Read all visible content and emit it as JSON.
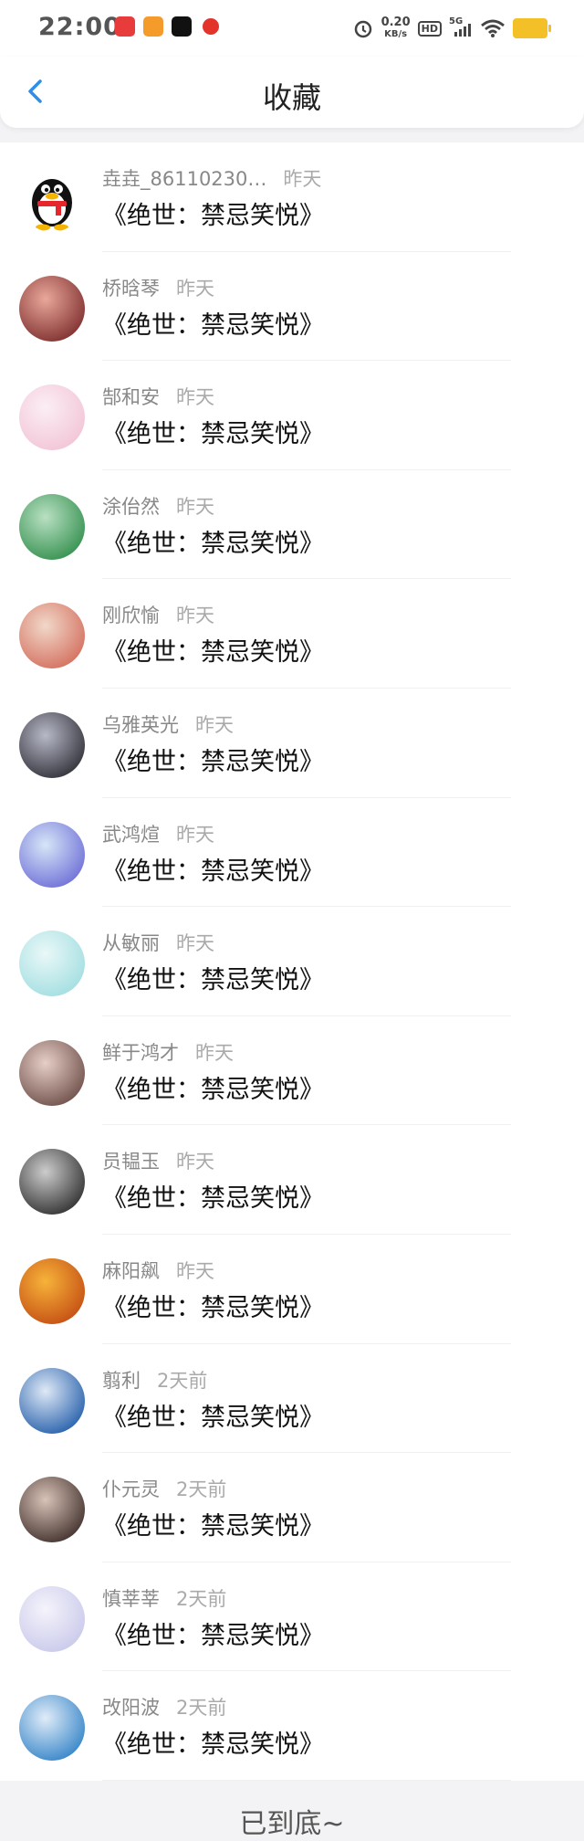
{
  "status": {
    "time": "22:00",
    "net_speed_value": "0.20",
    "net_speed_unit": "KB/s",
    "hd_label": "HD",
    "signal_label": "5G",
    "icons": [
      "alarm-icon",
      "hd-icon",
      "signal-icon",
      "wifi-icon",
      "battery-icon"
    ]
  },
  "header": {
    "title": "收藏"
  },
  "items": [
    {
      "name": "垚垚_86110230…",
      "time": "昨天",
      "msg": "《绝世：禁忌笑悦》",
      "avatar_kind": "qq-penguin"
    },
    {
      "name": "桥晗琴",
      "time": "昨天",
      "msg": "《绝世：禁忌笑悦》",
      "avatar_kind": "photo",
      "c1": "#7a2a2a",
      "c2": "#e9a79a"
    },
    {
      "name": "郜和安",
      "time": "昨天",
      "msg": "《绝世：禁忌笑悦》",
      "avatar_kind": "photo",
      "c1": "#f2c3d6",
      "c2": "#fbeef4"
    },
    {
      "name": "涂佁然",
      "time": "昨天",
      "msg": "《绝世：禁忌笑悦》",
      "avatar_kind": "photo",
      "c1": "#2f8d4a",
      "c2": "#b9e0c3"
    },
    {
      "name": "刚欣愉",
      "time": "昨天",
      "msg": "《绝世：禁忌笑悦》",
      "avatar_kind": "photo",
      "c1": "#d36b5a",
      "c2": "#f1d8c9"
    },
    {
      "name": "乌雅英光",
      "time": "昨天",
      "msg": "《绝世：禁忌笑悦》",
      "avatar_kind": "photo",
      "c1": "#2b2b33",
      "c2": "#b8b9c8"
    },
    {
      "name": "武鸿煊",
      "time": "昨天",
      "msg": "《绝世：禁忌笑悦》",
      "avatar_kind": "photo",
      "c1": "#6a6bd6",
      "c2": "#d6e6f7"
    },
    {
      "name": "从敏丽",
      "time": "昨天",
      "msg": "《绝世：禁忌笑悦》",
      "avatar_kind": "photo",
      "c1": "#9fdde0",
      "c2": "#eaf8f8"
    },
    {
      "name": "鲜于鸿才",
      "time": "昨天",
      "msg": "《绝世：禁忌笑悦》",
      "avatar_kind": "photo",
      "c1": "#6a4a45",
      "c2": "#e6cfc6"
    },
    {
      "name": "员韫玉",
      "time": "昨天",
      "msg": "《绝世：禁忌笑悦》",
      "avatar_kind": "photo",
      "c1": "#2a2a2a",
      "c2": "#cccccc"
    },
    {
      "name": "麻阳飙",
      "time": "昨天",
      "msg": "《绝世：禁忌笑悦》",
      "avatar_kind": "photo",
      "c1": "#c24a12",
      "c2": "#f7b33a"
    },
    {
      "name": "翦利",
      "time": "2天前",
      "msg": "《绝世：禁忌笑悦》",
      "avatar_kind": "photo",
      "c1": "#1e5aa8",
      "c2": "#dfe9f6"
    },
    {
      "name": "仆元灵",
      "time": "2天前",
      "msg": "《绝世：禁忌笑悦》",
      "avatar_kind": "photo",
      "c1": "#3a2a26",
      "c2": "#d9c3b8"
    },
    {
      "name": "慎莘莘",
      "time": "2天前",
      "msg": "《绝世：禁忌笑悦》",
      "avatar_kind": "photo",
      "c1": "#c7c8ea",
      "c2": "#f5f3fb"
    },
    {
      "name": "改阳波",
      "time": "2天前",
      "msg": "《绝世：禁忌笑悦》",
      "avatar_kind": "photo",
      "c1": "#2e80c6",
      "c2": "#e0ecf8"
    }
  ],
  "footer": {
    "text": "已到底~"
  }
}
